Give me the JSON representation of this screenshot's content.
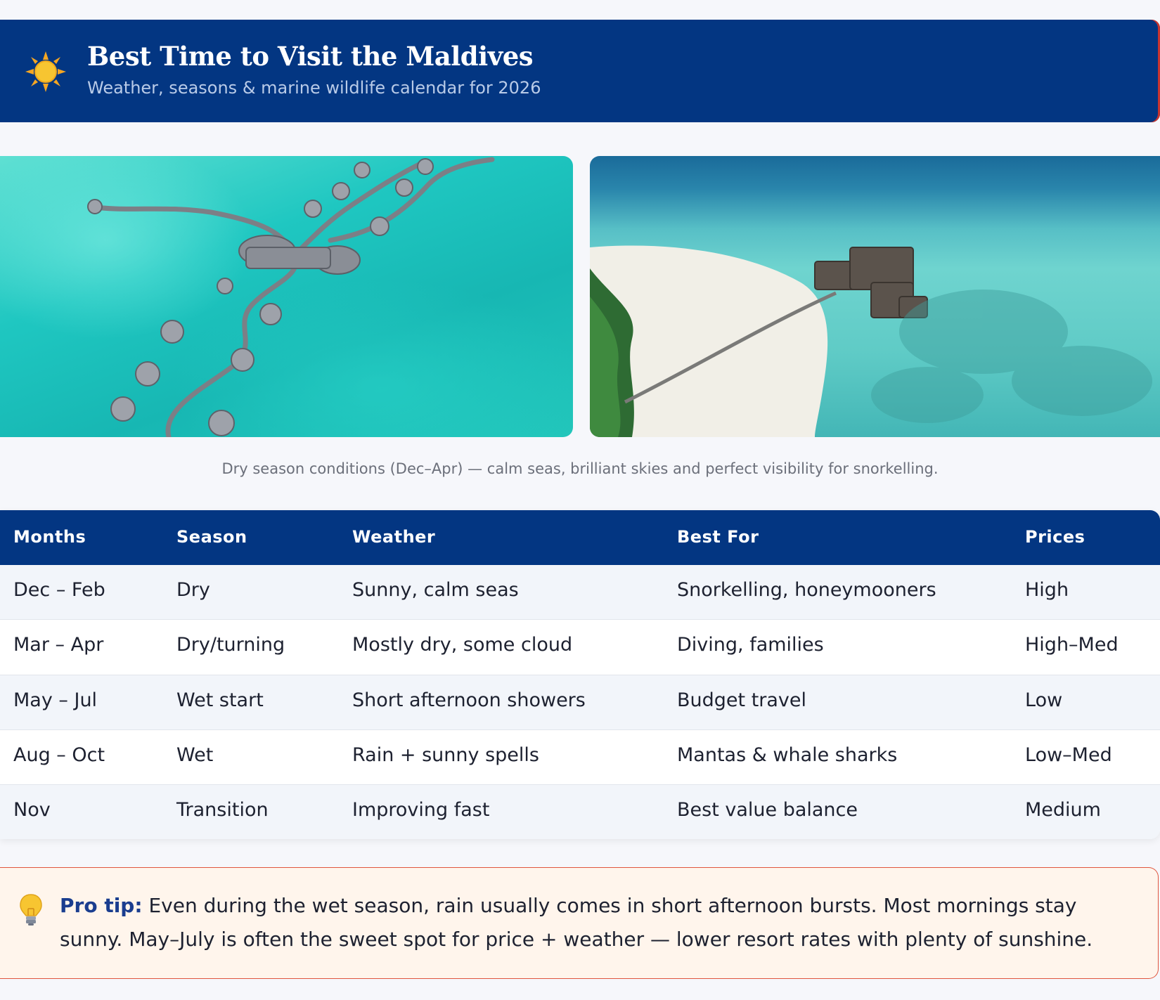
{
  "header": {
    "icon": "sun-icon",
    "title": "Best Time to Visit the Maldives",
    "subtitle": "Weather, seasons & marine wildlife calendar for 2026"
  },
  "caption": "Dry season conditions (Dec–Apr) — calm seas, brilliant skies and perfect visibility for snorkelling.",
  "table": {
    "headers": [
      "Months",
      "Season",
      "Weather",
      "Best For",
      "Prices"
    ],
    "rows": [
      [
        "Dec – Feb",
        "Dry",
        "Sunny, calm seas",
        "Snorkelling, honeymooners",
        "High"
      ],
      [
        "Mar – Apr",
        "Dry/turning",
        "Mostly dry, some cloud",
        "Diving, families",
        "High–Med"
      ],
      [
        "May – Jul",
        "Wet start",
        "Short afternoon showers",
        "Budget travel",
        "Low"
      ],
      [
        "Aug – Oct",
        "Wet",
        "Rain + sunny spells",
        "Mantas & whale sharks",
        "Low–Med"
      ],
      [
        "Nov",
        "Transition",
        "Improving fast",
        "Best value balance",
        "Medium"
      ]
    ]
  },
  "tip": {
    "icon": "lightbulb-icon",
    "label": "Pro tip:",
    "text": "Even during the wet season, rain usually comes in short afternoon bursts. Most mornings stay sunny. May–July is often the sweet spot for price + weather — lower resort rates with plenty of sunshine."
  },
  "colors": {
    "navy": "#033682",
    "tip_background": "#fff5ec",
    "tip_border": "#e0553e",
    "tip_label": "#1a3d8f"
  }
}
